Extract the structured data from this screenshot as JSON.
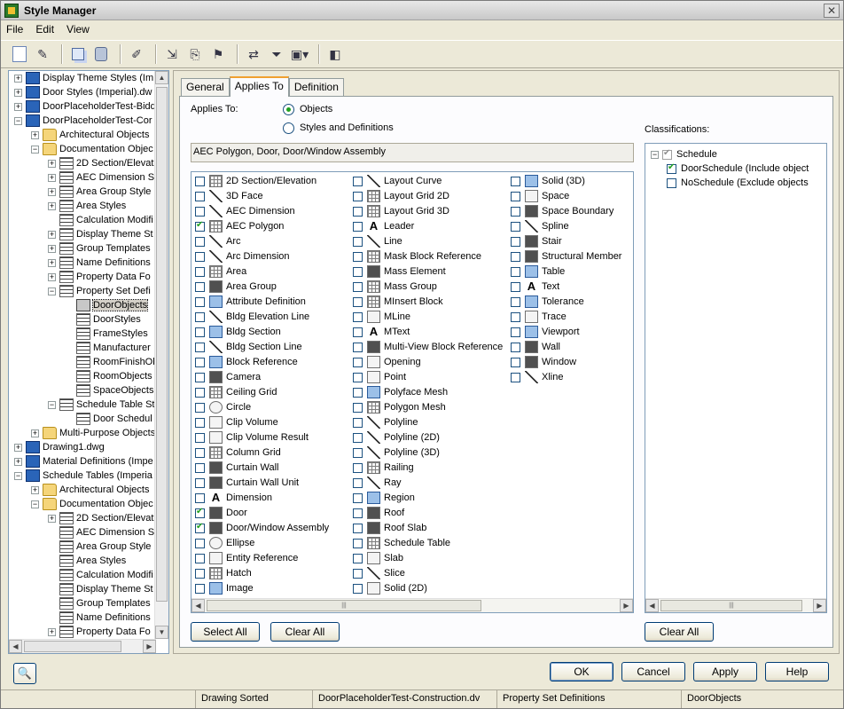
{
  "window": {
    "title": "Style Manager"
  },
  "menu": [
    "File",
    "Edit",
    "View"
  ],
  "tree": [
    {
      "label": "Display Theme Styles (Im",
      "expander": "+",
      "icon": "dwg",
      "indent": 0
    },
    {
      "label": "Door Styles (Imperial).dw",
      "expander": "+",
      "icon": "dwg",
      "indent": 0
    },
    {
      "label": "DoorPlaceholderTest-Bidd",
      "expander": "+",
      "icon": "dwg",
      "indent": 0
    },
    {
      "label": "DoorPlaceholderTest-Cor",
      "expander": "-",
      "icon": "dwg",
      "indent": 0
    },
    {
      "label": "Architectural Objects",
      "expander": "+",
      "icon": "folder",
      "indent": 1
    },
    {
      "label": "Documentation Objec",
      "expander": "-",
      "icon": "folder",
      "indent": 1
    },
    {
      "label": "2D Section/Elevat",
      "expander": "+",
      "icon": "style",
      "indent": 2
    },
    {
      "label": "AEC Dimension St",
      "expander": "+",
      "icon": "style",
      "indent": 2
    },
    {
      "label": "Area Group Style",
      "expander": "+",
      "icon": "style",
      "indent": 2
    },
    {
      "label": "Area Styles",
      "expander": "+",
      "icon": "style",
      "indent": 2
    },
    {
      "label": "Calculation Modifi",
      "expander": "",
      "icon": "style",
      "indent": 2
    },
    {
      "label": "Display Theme St",
      "expander": "+",
      "icon": "style",
      "indent": 2
    },
    {
      "label": "Group Templates",
      "expander": "+",
      "icon": "style",
      "indent": 2
    },
    {
      "label": "Name Definitions",
      "expander": "+",
      "icon": "style",
      "indent": 2
    },
    {
      "label": "Property Data Fo",
      "expander": "+",
      "icon": "style",
      "indent": 2
    },
    {
      "label": "Property Set Defi",
      "expander": "-",
      "icon": "style",
      "indent": 2
    },
    {
      "label": "DoorObjects",
      "expander": "",
      "icon": "sel",
      "indent": 3,
      "selected": true
    },
    {
      "label": "DoorStyles",
      "expander": "",
      "icon": "style",
      "indent": 3
    },
    {
      "label": "FrameStyles",
      "expander": "",
      "icon": "style",
      "indent": 3
    },
    {
      "label": "Manufacturer",
      "expander": "",
      "icon": "style",
      "indent": 3
    },
    {
      "label": "RoomFinishOb",
      "expander": "",
      "icon": "style",
      "indent": 3
    },
    {
      "label": "RoomObjects",
      "expander": "",
      "icon": "style",
      "indent": 3
    },
    {
      "label": "SpaceObjects",
      "expander": "",
      "icon": "style",
      "indent": 3
    },
    {
      "label": "Schedule Table St",
      "expander": "-",
      "icon": "style",
      "indent": 2
    },
    {
      "label": "Door Schedul",
      "expander": "",
      "icon": "style",
      "indent": 3
    },
    {
      "label": "Multi-Purpose Objects",
      "expander": "+",
      "icon": "folder",
      "indent": 1
    },
    {
      "label": "Drawing1.dwg",
      "expander": "+",
      "icon": "dwg",
      "indent": 0
    },
    {
      "label": "Material Definitions (Impe",
      "expander": "+",
      "icon": "dwg",
      "indent": 0
    },
    {
      "label": "Schedule Tables (Imperia",
      "expander": "-",
      "icon": "dwg",
      "indent": 0
    },
    {
      "label": "Architectural Objects",
      "expander": "+",
      "icon": "folder",
      "indent": 1
    },
    {
      "label": "Documentation Objec",
      "expander": "-",
      "icon": "folder",
      "indent": 1
    },
    {
      "label": "2D Section/Elevat",
      "expander": "+",
      "icon": "style",
      "indent": 2
    },
    {
      "label": "AEC Dimension St",
      "expander": "",
      "icon": "style",
      "indent": 2
    },
    {
      "label": "Area Group Style",
      "expander": "",
      "icon": "style",
      "indent": 2
    },
    {
      "label": "Area Styles",
      "expander": "",
      "icon": "style",
      "indent": 2
    },
    {
      "label": "Calculation Modifi",
      "expander": "",
      "icon": "style",
      "indent": 2
    },
    {
      "label": "Display Theme St",
      "expander": "",
      "icon": "style",
      "indent": 2
    },
    {
      "label": "Group Templates",
      "expander": "",
      "icon": "style",
      "indent": 2
    },
    {
      "label": "Name Definitions",
      "expander": "",
      "icon": "style",
      "indent": 2
    },
    {
      "label": "Property Data Fo",
      "expander": "+",
      "icon": "style",
      "indent": 2
    }
  ],
  "tabs": [
    "General",
    "Applies To",
    "Definition"
  ],
  "applies_to": {
    "label": "Applies To:",
    "option_objects": "Objects",
    "option_styles": "Styles and Definitions",
    "summary": "AEC Polygon, Door, Door/Window Assembly",
    "columns": [
      [
        {
          "label": "2D Section/Elevation",
          "checked": false,
          "icon": "grid"
        },
        {
          "label": "3D Face",
          "checked": false,
          "icon": "line"
        },
        {
          "label": "AEC Dimension",
          "checked": false,
          "icon": "line"
        },
        {
          "label": "AEC Polygon",
          "checked": true,
          "icon": "grid"
        },
        {
          "label": "Arc",
          "checked": false,
          "icon": "line"
        },
        {
          "label": "Arc Dimension",
          "checked": false,
          "icon": "line"
        },
        {
          "label": "Area",
          "checked": false,
          "icon": "grid"
        },
        {
          "label": "Area Group",
          "checked": false,
          "icon": "dark"
        },
        {
          "label": "Attribute Definition",
          "checked": false,
          "icon": "blue"
        },
        {
          "label": "Bldg Elevation Line",
          "checked": false,
          "icon": "line"
        },
        {
          "label": "Bldg Section",
          "checked": false,
          "icon": "blue"
        },
        {
          "label": "Bldg Section Line",
          "checked": false,
          "icon": "line"
        },
        {
          "label": "Block Reference",
          "checked": false,
          "icon": "blue"
        },
        {
          "label": "Camera",
          "checked": false,
          "icon": "dark"
        },
        {
          "label": "Ceiling Grid",
          "checked": false,
          "icon": "grid"
        },
        {
          "label": "Circle",
          "checked": false,
          "icon": "circle"
        },
        {
          "label": "Clip Volume",
          "checked": false,
          "icon": "plain"
        },
        {
          "label": "Clip Volume Result",
          "checked": false,
          "icon": "plain"
        },
        {
          "label": "Column Grid",
          "checked": false,
          "icon": "grid"
        },
        {
          "label": "Curtain Wall",
          "checked": false,
          "icon": "dark"
        },
        {
          "label": "Curtain Wall Unit",
          "checked": false,
          "icon": "dark"
        },
        {
          "label": "Dimension",
          "checked": false,
          "icon": "letter"
        },
        {
          "label": "Door",
          "checked": true,
          "icon": "dark"
        },
        {
          "label": "Door/Window Assembly",
          "checked": true,
          "icon": "dark"
        },
        {
          "label": "Ellipse",
          "checked": false,
          "icon": "circle"
        },
        {
          "label": "Entity Reference",
          "checked": false,
          "icon": "plain"
        },
        {
          "label": "Hatch",
          "checked": false,
          "icon": "grid"
        },
        {
          "label": "Image",
          "checked": false,
          "icon": "blue"
        }
      ],
      [
        {
          "label": "Layout Curve",
          "checked": false,
          "icon": "line"
        },
        {
          "label": "Layout Grid 2D",
          "checked": false,
          "icon": "grid"
        },
        {
          "label": "Layout Grid 3D",
          "checked": false,
          "icon": "grid"
        },
        {
          "label": "Leader",
          "checked": false,
          "icon": "letter"
        },
        {
          "label": "Line",
          "checked": false,
          "icon": "line"
        },
        {
          "label": "Mask Block Reference",
          "checked": false,
          "icon": "grid"
        },
        {
          "label": "Mass Element",
          "checked": false,
          "icon": "dark"
        },
        {
          "label": "Mass Group",
          "checked": false,
          "icon": "grid"
        },
        {
          "label": "MInsert Block",
          "checked": false,
          "icon": "grid"
        },
        {
          "label": "MLine",
          "checked": false,
          "icon": "plain"
        },
        {
          "label": "MText",
          "checked": false,
          "icon": "letter"
        },
        {
          "label": "Multi-View Block Reference",
          "checked": false,
          "icon": "dark"
        },
        {
          "label": "Opening",
          "checked": false,
          "icon": "plain"
        },
        {
          "label": "Point",
          "checked": false,
          "icon": "plain"
        },
        {
          "label": "Polyface Mesh",
          "checked": false,
          "icon": "blue"
        },
        {
          "label": "Polygon Mesh",
          "checked": false,
          "icon": "grid"
        },
        {
          "label": "Polyline",
          "checked": false,
          "icon": "line"
        },
        {
          "label": "Polyline (2D)",
          "checked": false,
          "icon": "line"
        },
        {
          "label": "Polyline (3D)",
          "checked": false,
          "icon": "line"
        },
        {
          "label": "Railing",
          "checked": false,
          "icon": "grid"
        },
        {
          "label": "Ray",
          "checked": false,
          "icon": "line"
        },
        {
          "label": "Region",
          "checked": false,
          "icon": "blue"
        },
        {
          "label": "Roof",
          "checked": false,
          "icon": "dark"
        },
        {
          "label": "Roof Slab",
          "checked": false,
          "icon": "dark"
        },
        {
          "label": "Schedule Table",
          "checked": false,
          "icon": "grid"
        },
        {
          "label": "Slab",
          "checked": false,
          "icon": "plain"
        },
        {
          "label": "Slice",
          "checked": false,
          "icon": "line"
        },
        {
          "label": "Solid (2D)",
          "checked": false,
          "icon": "plain"
        }
      ],
      [
        {
          "label": "Solid (3D)",
          "checked": false,
          "icon": "blue"
        },
        {
          "label": "Space",
          "checked": false,
          "icon": "plain"
        },
        {
          "label": "Space Boundary",
          "checked": false,
          "icon": "dark"
        },
        {
          "label": "Spline",
          "checked": false,
          "icon": "line"
        },
        {
          "label": "Stair",
          "checked": false,
          "icon": "dark"
        },
        {
          "label": "Structural Member",
          "checked": false,
          "icon": "dark"
        },
        {
          "label": "Table",
          "checked": false,
          "icon": "blue"
        },
        {
          "label": "Text",
          "checked": false,
          "icon": "letter"
        },
        {
          "label": "Tolerance",
          "checked": false,
          "icon": "blue"
        },
        {
          "label": "Trace",
          "checked": false,
          "icon": "plain"
        },
        {
          "label": "Viewport",
          "checked": false,
          "icon": "blue"
        },
        {
          "label": "Wall",
          "checked": false,
          "icon": "dark"
        },
        {
          "label": "Window",
          "checked": false,
          "icon": "dark"
        },
        {
          "label": "Xline",
          "checked": false,
          "icon": "line"
        }
      ]
    ],
    "select_all": "Select All",
    "clear_all": "Clear All"
  },
  "classifications": {
    "label": "Classifications:",
    "items": [
      {
        "label": "Schedule",
        "checked": true,
        "expander": "-",
        "indent": 0,
        "gray": true
      },
      {
        "label": "DoorSchedule (Include object",
        "checked": true,
        "expander": "",
        "indent": 1,
        "gray": false
      },
      {
        "label": "NoSchedule (Exclude objects",
        "checked": false,
        "expander": "",
        "indent": 1,
        "gray": false
      }
    ],
    "clear_all": "Clear All"
  },
  "footer": {
    "ok": "OK",
    "cancel": "Cancel",
    "apply": "Apply",
    "help": "Help"
  },
  "statusbar": [
    "",
    "Drawing Sorted",
    "DoorPlaceholderTest-Construction.dv",
    "Property Set Definitions",
    "DoorObjects"
  ],
  "letter_icons": {
    "Dimension": "A",
    "Leader": "A",
    "MText": "A",
    "Text": "A"
  }
}
